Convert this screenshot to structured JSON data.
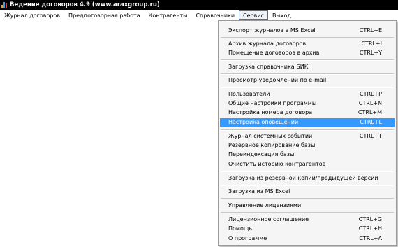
{
  "window": {
    "title": "Ведение договоров 4.9 (www.araxgroup.ru)"
  },
  "menubar": {
    "items": [
      {
        "label": "Журнал договоров"
      },
      {
        "label": "Преддоговорная работа"
      },
      {
        "label": "Контрагенты"
      },
      {
        "label": "Справочники"
      },
      {
        "label": "Сервис",
        "active": true
      },
      {
        "label": "Выход"
      }
    ]
  },
  "service_menu": {
    "items": [
      {
        "label": "Экспорт журналов в MS Excel",
        "shortcut": "CTRL+E"
      },
      {
        "label": "Архив журнала договоров",
        "shortcut": "CTRL+I"
      },
      {
        "label": "Помещение договоров в архив",
        "shortcut": "CTRL+Y"
      },
      {
        "label": "Загрузка справочника БИК",
        "shortcut": ""
      },
      {
        "label": "Просмотр уведомлений по e-mail",
        "shortcut": ""
      },
      {
        "label": "Пользователи",
        "shortcut": "CTRL+P"
      },
      {
        "label": "Общие настройки программы",
        "shortcut": "CTRL+N"
      },
      {
        "label": "Настройка номера договора",
        "shortcut": "CTRL+M"
      },
      {
        "label": "Настройка оповещений",
        "shortcut": "CTRL+L",
        "selected": true
      },
      {
        "label": "Журнал системных событий",
        "shortcut": "CTRL+T"
      },
      {
        "label": "Резервное копирование базы",
        "shortcut": ""
      },
      {
        "label": "Переиндексация базы",
        "shortcut": ""
      },
      {
        "label": "Очистить историю контрагентов",
        "shortcut": ""
      },
      {
        "label": "Загрузка из резервной копии/предыдущей версии",
        "shortcut": ""
      },
      {
        "label": "Загрузка из MS Excel",
        "shortcut": ""
      },
      {
        "label": "Управление лицензиями",
        "shortcut": ""
      },
      {
        "label": "Лицензионное соглашение",
        "shortcut": "CTRL+G"
      },
      {
        "label": "Помощь",
        "shortcut": "CTRL+H"
      },
      {
        "label": "О программе",
        "shortcut": "CTRL+A"
      }
    ]
  },
  "colors": {
    "titlebar_bg": "#000000",
    "selection_bg": "#3399ff",
    "menu_bg": "#f5f5f5"
  }
}
